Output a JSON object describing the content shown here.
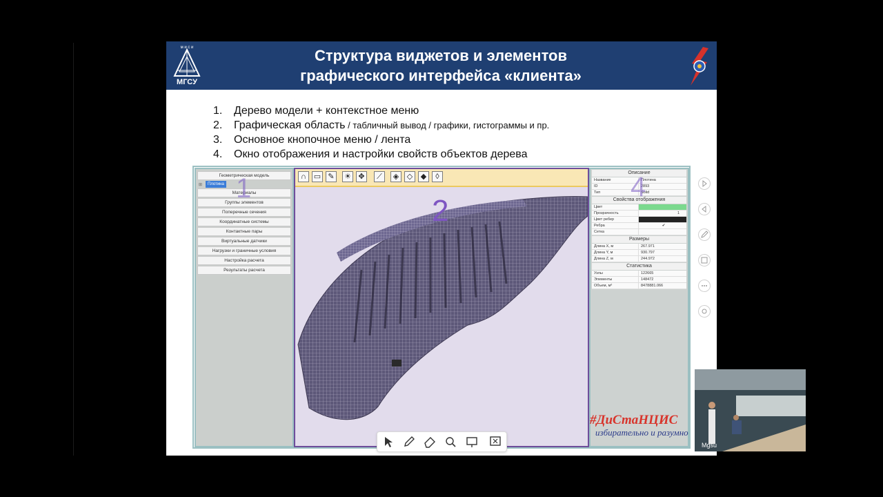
{
  "slide": {
    "title_line1": "Структура виджетов и элементов",
    "title_line2": "графического интерфейса «клиента»",
    "logo_left_text": "МГСУ",
    "logo_left_top": "м и с и",
    "list": [
      {
        "num": "1.",
        "main": "Дерево модели + контекстное меню",
        "extra": ""
      },
      {
        "num": "2.",
        "main": "Графическая область",
        "extra": " / табличный вывод / графики, гистограммы и пр."
      },
      {
        "num": "3.",
        "main": "Основное кнопочное меню / лента",
        "extra": ""
      },
      {
        "num": "4.",
        "main": "Окно отображения и настройки свойств объектов дерева",
        "extra": ""
      }
    ]
  },
  "app": {
    "overlay_numbers": {
      "tree": "1",
      "graphics": "2",
      "props": "4"
    },
    "tree": {
      "header": "Геометрическая модель",
      "selected_node": "Плотина",
      "buttons": [
        "Материалы",
        "Группы элементов",
        "Поперечные сечения",
        "Координатные системы",
        "Контактные пары",
        "Виртуальные датчики",
        "Нагрузки и граничные условия",
        "Настройка расчета",
        "Результаты расчета"
      ]
    },
    "ribbon_icons": [
      "arch-icon",
      "folder-icon",
      "pencil-icon",
      "bulb-icon",
      "move-icon",
      "wrench-icon",
      "cube-icon",
      "cube-front-icon",
      "cube-side-icon",
      "cube-iso-icon"
    ],
    "properties": {
      "sections": [
        {
          "title": "Описание",
          "rows": [
            {
              "k": "Название",
              "v": "Плотина"
            },
            {
              "k": "ID",
              "v": "2893"
            },
            {
              "k": "Тип",
              "v": "Solid"
            }
          ]
        },
        {
          "title": "Свойства отображения",
          "rows": [
            {
              "k": "Цвет",
              "v": ""
            },
            {
              "k": "Прозрачность",
              "v": "1"
            },
            {
              "k": "Цвет ребер",
              "v": ""
            },
            {
              "k": "Ребра",
              "v": "✔"
            },
            {
              "k": "Сетка",
              "v": ""
            }
          ]
        },
        {
          "title": "Размеры",
          "rows": [
            {
              "k": "Длина X, м",
              "v": "267.971"
            },
            {
              "k": "Длина Y, м",
              "v": "930.797"
            },
            {
              "k": "Длина Z, м",
              "v": "244.972"
            }
          ]
        },
        {
          "title": "Статистика",
          "rows": [
            {
              "k": "Узлы",
              "v": "122665"
            },
            {
              "k": "Элементы",
              "v": "148472"
            },
            {
              "k": "Объем, м³",
              "v": "8478881.066"
            }
          ]
        }
      ],
      "color_swatch": "#7bd98e",
      "edge_color": "#222222"
    }
  },
  "presenter_toolbar": [
    "pointer-icon",
    "pen-icon",
    "eraser-icon",
    "zoom-icon",
    "screen-icon",
    "close-presentation-icon"
  ],
  "side_icons": [
    "play-next-icon",
    "play-prev-icon",
    "pen-icon",
    "subtitle-icon",
    "more-icon",
    "settings-icon"
  ],
  "webcam": {
    "name": "Mgsu"
  },
  "banner": {
    "hashtag": "#ДиСтаНЦИС",
    "slogan": "избирательно и разумно"
  },
  "colors": {
    "banner_bg": "#1f3f72",
    "tree_border": "#9bc0c2",
    "graphics_border": "#6e4d9b",
    "ribbon_bg": "#f9e7b5"
  }
}
